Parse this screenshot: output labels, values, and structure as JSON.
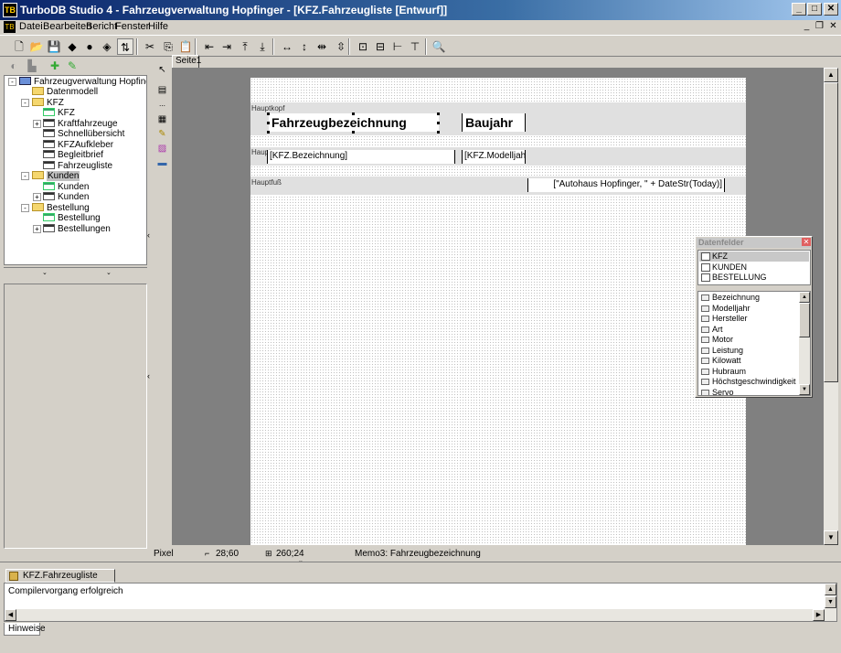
{
  "window": {
    "title": "TurboDB Studio 4 -  Fahrzeugverwaltung Hopfinger - [KFZ.Fahrzeugliste [Entwurf]]",
    "app_icon": "turbodb-app-icon",
    "buttons": {
      "minimize": "_",
      "maximize": "□",
      "close": "✕"
    }
  },
  "menu": {
    "items": [
      "Datei",
      "Bearbeiten",
      "Bericht",
      "Fenster",
      "Hilfe"
    ],
    "mdi_buttons": {
      "minimize": "_",
      "restore": "❐",
      "close": "✕"
    }
  },
  "toolbar": {
    "icons": [
      {
        "name": "new-icon",
        "glyph": "🗋"
      },
      {
        "name": "open-icon",
        "glyph": "📂"
      },
      {
        "name": "save-icon",
        "glyph": "💾"
      },
      {
        "name": "database-icon",
        "glyph": "◆"
      },
      {
        "name": "globe-icon",
        "glyph": "●"
      },
      {
        "name": "eraser-icon",
        "glyph": "◈"
      },
      {
        "name": "tab-order-icon",
        "glyph": "⇅"
      },
      {
        "name": "cut-icon",
        "glyph": "✂"
      },
      {
        "name": "copy-icon",
        "glyph": "⎘"
      },
      {
        "name": "paste-icon",
        "glyph": "📋"
      },
      {
        "name": "align-left-icon",
        "glyph": "⇤"
      },
      {
        "name": "align-right-icon",
        "glyph": "⇥"
      },
      {
        "name": "align-top-icon",
        "glyph": "⤒"
      },
      {
        "name": "align-bottom-icon",
        "glyph": "⤓"
      },
      {
        "name": "same-width-icon",
        "glyph": "↔"
      },
      {
        "name": "same-height-icon",
        "glyph": "↕"
      },
      {
        "name": "space-horizontal-icon",
        "glyph": "⇹"
      },
      {
        "name": "space-vertical-icon",
        "glyph": "⇳"
      },
      {
        "name": "center-horizontal-icon",
        "glyph": "⊡"
      },
      {
        "name": "center-vertical-icon",
        "glyph": "⊟"
      },
      {
        "name": "center-h-page-icon",
        "glyph": "⊢"
      },
      {
        "name": "center-v-page-icon",
        "glyph": "⊤"
      },
      {
        "name": "preview-icon",
        "glyph": "🔍"
      }
    ]
  },
  "tree": {
    "root": "Fahrzeugverwaltung Hopfinger",
    "nodes": [
      {
        "label": "Datenmodell",
        "icon": "folder-icon",
        "level": 1
      },
      {
        "label": "KFZ",
        "icon": "folder-icon",
        "level": 1,
        "expanded": true
      },
      {
        "label": "KFZ",
        "icon": "table-icon",
        "level": 2
      },
      {
        "label": "Kraftfahrzeuge",
        "icon": "report-icon",
        "level": 2,
        "expandable": true
      },
      {
        "label": "Schnellübersicht",
        "icon": "report-icon",
        "level": 2
      },
      {
        "label": "KFZAufkleber",
        "icon": "report-icon",
        "level": 2
      },
      {
        "label": "Begleitbrief",
        "icon": "report-icon",
        "level": 2
      },
      {
        "label": "Fahrzeugliste",
        "icon": "report-icon",
        "level": 2
      },
      {
        "label": "Kunden",
        "icon": "folder-icon",
        "level": 1,
        "expanded": true,
        "selected": true
      },
      {
        "label": "Kunden",
        "icon": "table-icon",
        "level": 2
      },
      {
        "label": "Kunden",
        "icon": "report-icon",
        "level": 2,
        "expandable": true
      },
      {
        "label": "Bestellung",
        "icon": "folder-icon",
        "level": 1,
        "expanded": true
      },
      {
        "label": "Bestellung",
        "icon": "table-icon",
        "level": 2
      },
      {
        "label": "Bestellungen",
        "icon": "report-icon",
        "level": 2,
        "expandable": true
      }
    ]
  },
  "designer": {
    "tab": "Seite1",
    "bands": {
      "header": "Hauptkopf",
      "data": "Haupt",
      "footer": "Hauptfuß"
    },
    "fields": {
      "title_label": "Fahrzeugbezeichnung",
      "year_label": "Baujahr",
      "bezeichnung": "[KFZ.Bezeichnung]",
      "modelljahr": "[KFZ.Modelljahr]",
      "footer_expr": "[\"Autohaus Hopfinger, \" + DateStr(Today)]"
    }
  },
  "statusbar": {
    "unit": "Pixel",
    "position": "28;60",
    "size": "260;24",
    "selection": "Memo3: Fahrzeugbezeichnung"
  },
  "datenfelder": {
    "title": "Datenfelder",
    "tables": [
      "KFZ",
      "KUNDEN",
      "BESTELLUNG"
    ],
    "fields": [
      "Bezeichnung",
      "Modelljahr",
      "Hersteller",
      "Art",
      "Motor",
      "Leistung",
      "Kilowatt",
      "Hubraum",
      "Höchstgeschwindigkeit",
      "Servo"
    ]
  },
  "bottom": {
    "doc_tab": "KFZ.Fahrzeugliste [Entwurf]",
    "output": "Compilervorgang erfolgreich",
    "hint_tab": "Hinweise"
  }
}
